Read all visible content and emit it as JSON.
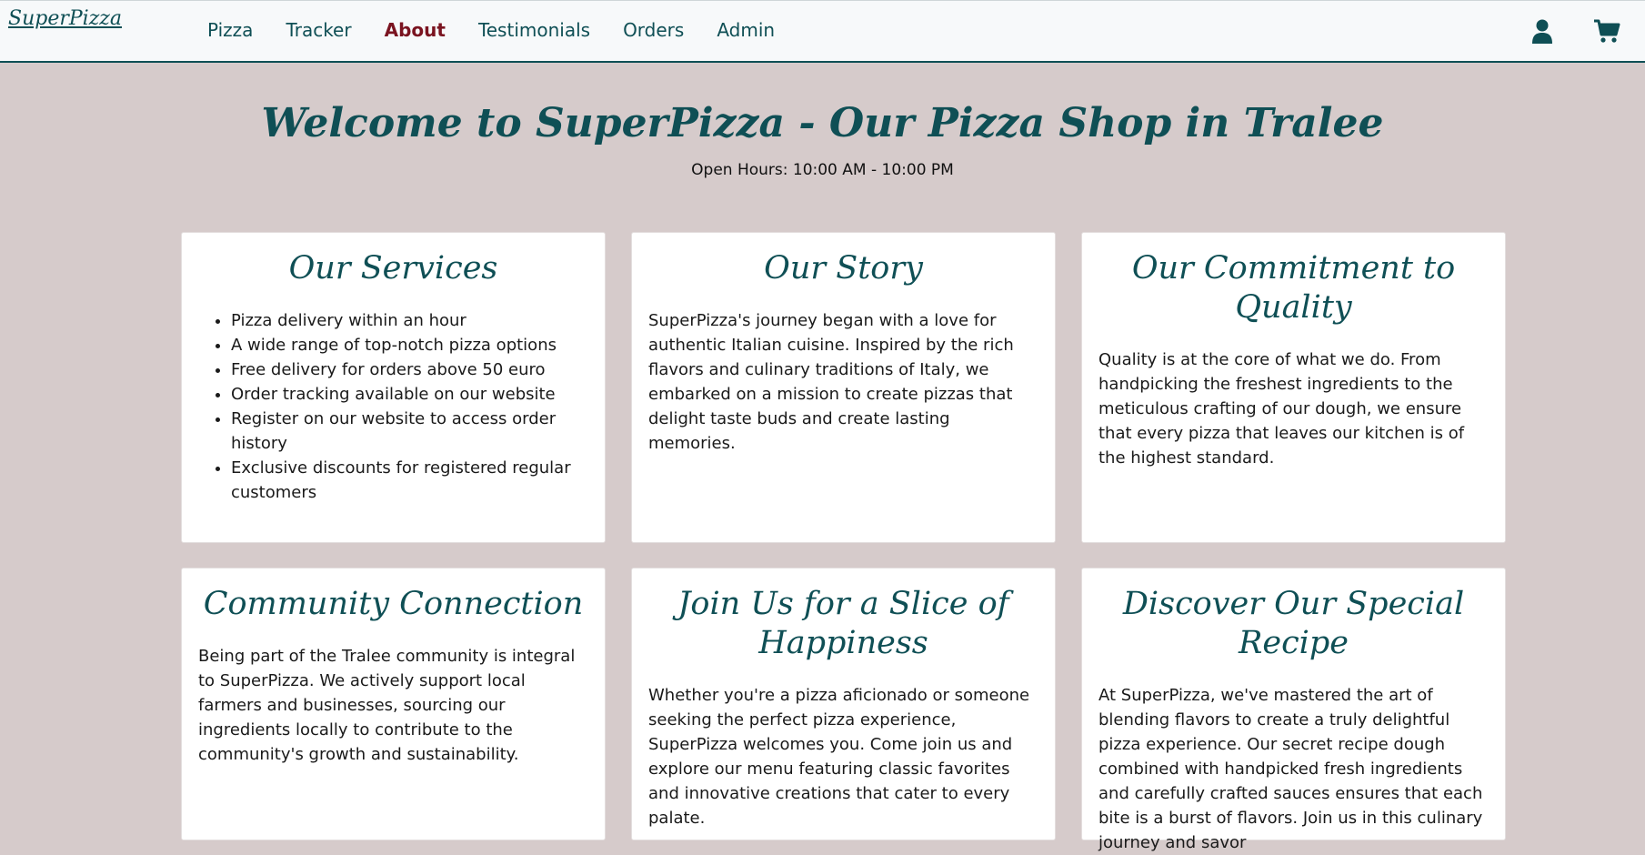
{
  "nav": {
    "brand": "SuperPizza",
    "links": [
      {
        "label": "Pizza"
      },
      {
        "label": "Tracker"
      },
      {
        "label": "About"
      },
      {
        "label": "Testimonials"
      },
      {
        "label": "Orders"
      },
      {
        "label": "Admin"
      }
    ],
    "active_link": "About",
    "icons": [
      "user-icon",
      "cart-icon"
    ]
  },
  "hero": {
    "title": "Welcome to SuperPizza - Our Pizza Shop in Tralee",
    "hours": "Open Hours: 10:00 AM - 10:00 PM"
  },
  "cards": {
    "services": {
      "title": "Our Services",
      "items": [
        "Pizza delivery within an hour",
        "A wide range of top-notch pizza options",
        "Free delivery for orders above 50 euro",
        "Order tracking available on our website",
        "Register on our website to access order history",
        "Exclusive discounts for registered regular customers"
      ]
    },
    "story": {
      "title": "Our Story",
      "text": "SuperPizza's journey began with a love for authentic Italian cuisine. Inspired by the rich flavors and culinary traditions of Italy, we embarked on a mission to create pizzas that delight taste buds and create lasting memories."
    },
    "quality": {
      "title": "Our Commitment to Quality",
      "text": "Quality is at the core of what we do. From handpicking the freshest ingredients to the meticulous crafting of our dough, we ensure that every pizza that leaves our kitchen is of the highest standard."
    },
    "community": {
      "title": "Community Connection",
      "text": "Being part of the Tralee community is integral to SuperPizza. We actively support local farmers and businesses, sourcing our ingredients locally to contribute to the community's growth and sustainability."
    },
    "join": {
      "title": "Join Us for a Slice of Happiness",
      "text": "Whether you're a pizza aficionado or someone seeking the perfect pizza experience, SuperPizza welcomes you. Come join us and explore our menu featuring classic favorites and innovative creations that cater to every palate."
    },
    "recipe": {
      "title": "Discover Our Special Recipe",
      "text": "At SuperPizza, we've mastered the art of blending flavors to create a truly delightful pizza experience. Our secret recipe dough combined with handpicked fresh ingredients and carefully crafted sauces ensures that each bite is a burst of flavors. Join us in this culinary journey and savor"
    }
  },
  "colors": {
    "background": "#d6cbcb",
    "brand": "#0f4f55",
    "active_nav": "#7a1420",
    "card": "#ffffff"
  }
}
